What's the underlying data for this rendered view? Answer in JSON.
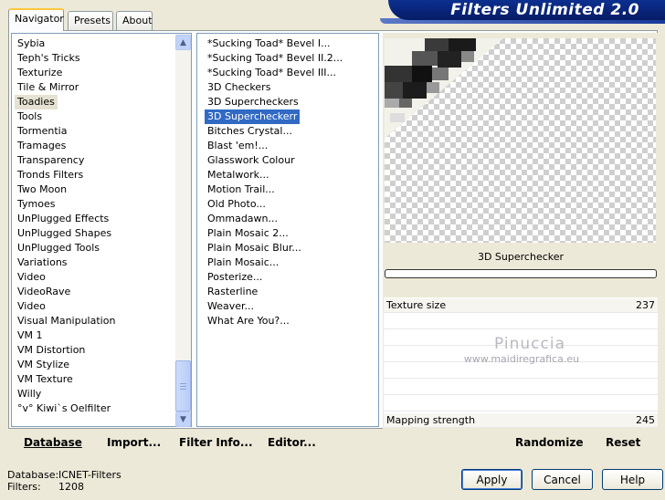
{
  "tabs": [
    "Navigator",
    "Presets",
    "About"
  ],
  "window_title": "Filters Unlimited 2.0",
  "categories": [
    "Sybia",
    "Teph's Tricks",
    "Texturize",
    "Tile & Mirror",
    "Toadies",
    "Tools",
    "Tormentia",
    "Tramages",
    "Transparency",
    "Tronds Filters",
    "Two Moon",
    "Tymoes",
    "UnPlugged Effects",
    "UnPlugged Shapes",
    "UnPlugged Tools",
    "Variations",
    "Video",
    "VideoRave",
    "Video",
    "Visual Manipulation",
    "VM 1",
    "VM Distortion",
    "VM Stylize",
    "VM Texture",
    "Willy",
    "°v° Kiwi`s Oelfilter"
  ],
  "filters": [
    "*Sucking Toad*  Bevel I...",
    "*Sucking Toad*  Bevel II.2...",
    "*Sucking Toad*  Bevel III...",
    "3D Checkers",
    "3D Supercheckers",
    "3D Supercheckerr",
    "Bitches Crystal...",
    "Blast 'em!...",
    "Glasswork Colour",
    "Metalwork...",
    "Motion Trail...",
    "Old Photo...",
    "Ommadawn...",
    "Plain Mosaic 2...",
    "Plain Mosaic Blur...",
    "Plain Mosaic...",
    "Posterize...",
    "Rasterline",
    "Weaver...",
    "What Are You?..."
  ],
  "selected_filter_name": "3D Superchecker",
  "params": {
    "texture_label": "Texture size",
    "texture_value": "237",
    "mapping_label": "Mapping strength",
    "mapping_value": "245"
  },
  "watermark": {
    "name": "Pinuccia",
    "url": "www.maidiregrafica.eu"
  },
  "bottom_left_buttons": {
    "database": "Database",
    "import": "Import...",
    "filter_info": "Filter Info...",
    "editor": "Editor..."
  },
  "bottom_right_buttons": {
    "randomize": "Randomize",
    "reset": "Reset"
  },
  "status": {
    "database_label": "Database:",
    "database_value": "ICNET-Filters",
    "filters_label": "Filters:",
    "filters_value": "1208"
  },
  "dialog_buttons": {
    "apply": "Apply",
    "cancel": "Cancel",
    "help": "Help"
  },
  "colors": {
    "selection": "#316ac5",
    "banner": "#0c2f8f",
    "dialog_bg": "#ece9d8"
  }
}
